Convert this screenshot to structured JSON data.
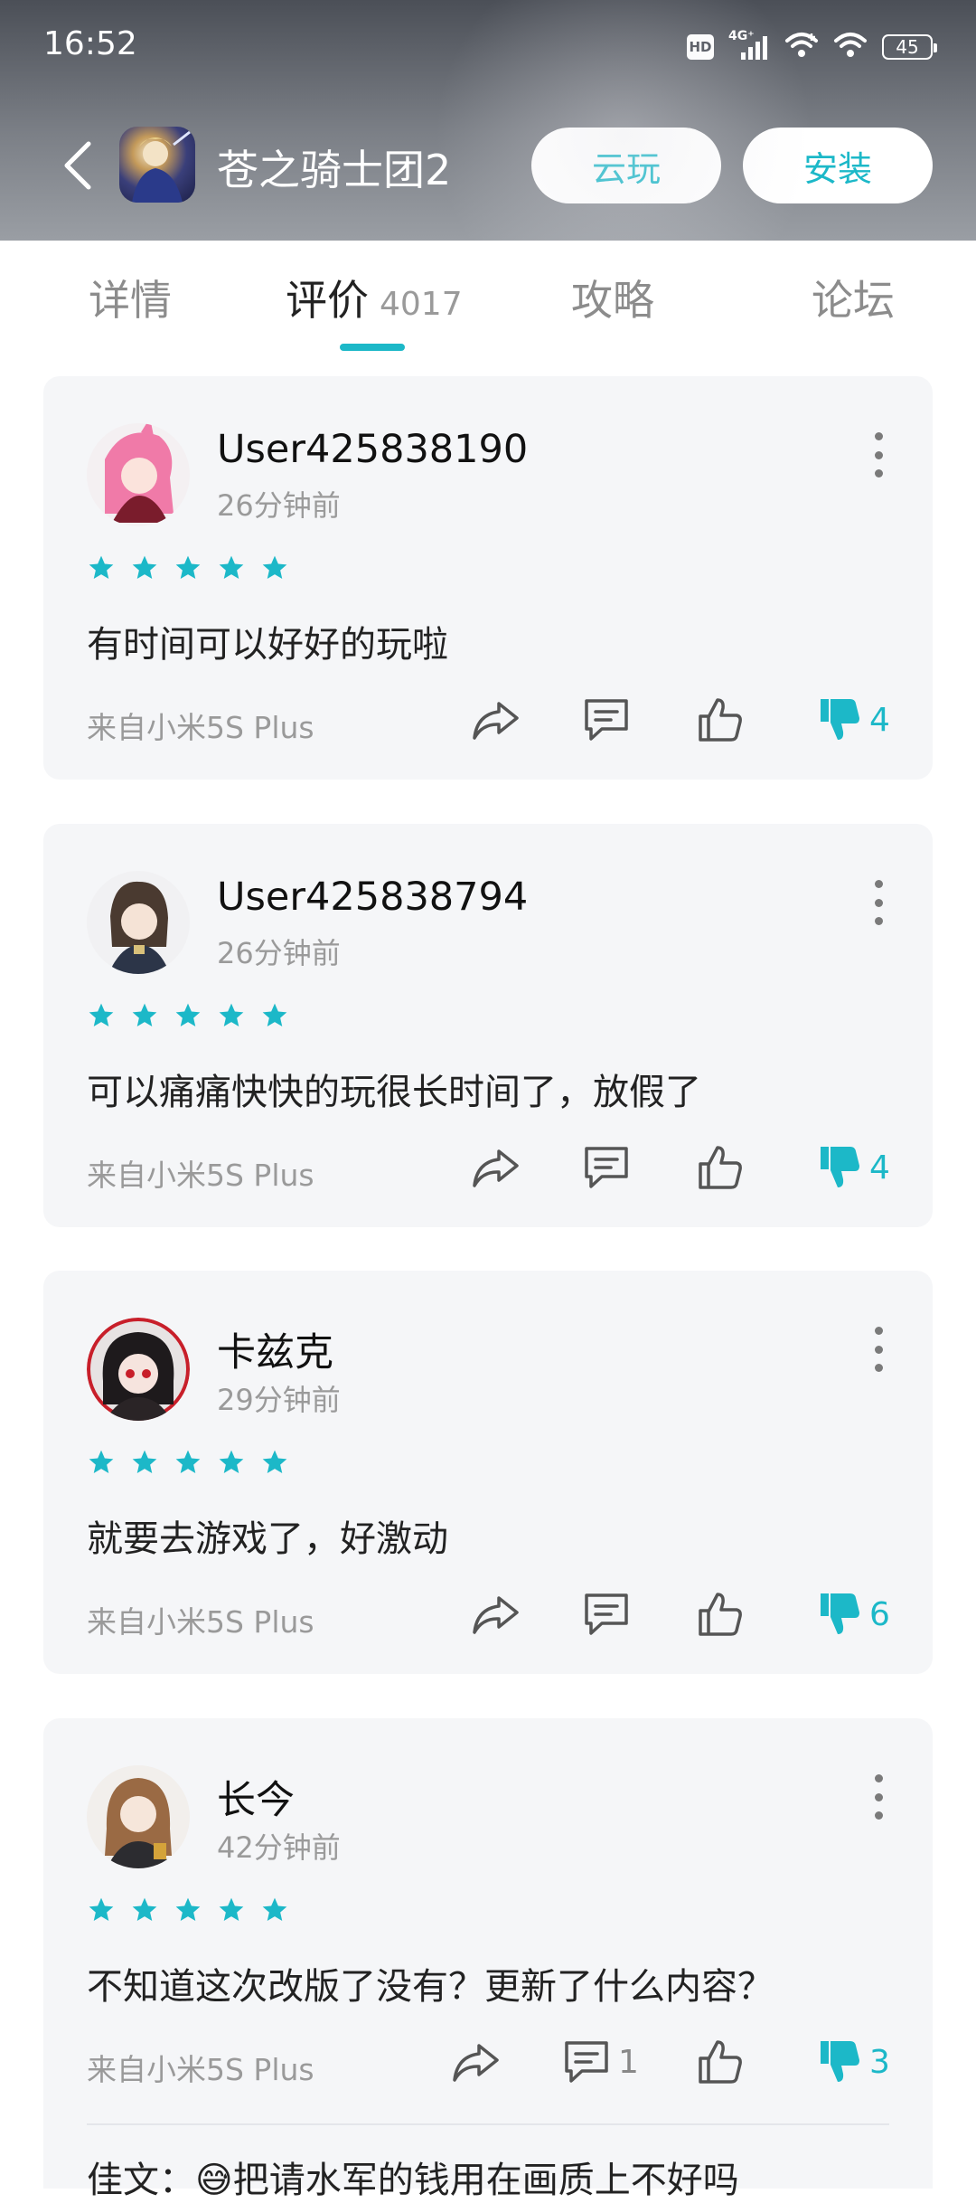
{
  "status_bar": {
    "time": "16:52",
    "hd": "HD",
    "network": "4G⁺",
    "battery": "45"
  },
  "header": {
    "app_title": "苍之骑士团2",
    "cloud_play_label": "云玩",
    "install_label": "安装"
  },
  "tabs": [
    {
      "label": "详情"
    },
    {
      "label": "评价",
      "count": "4017"
    },
    {
      "label": "攻略"
    },
    {
      "label": "论坛"
    }
  ],
  "colors": {
    "accent": "#1cb8c8",
    "card_bg": "#f5f6f8",
    "text_primary": "#222222",
    "text_secondary": "#9a9a9a"
  },
  "reviews": [
    {
      "user": "User425838190",
      "time": "26分钟前",
      "rating": 5,
      "text": "有时间可以好好的玩啦",
      "device": "来自小米5S Plus",
      "comment_count": "",
      "dislike_count": "4"
    },
    {
      "user": "User425838794",
      "time": "26分钟前",
      "rating": 5,
      "text": "可以痛痛快快的玩很长时间了，放假了",
      "device": "来自小米5S Plus",
      "comment_count": "",
      "dislike_count": "4"
    },
    {
      "user": "卡兹克",
      "time": "29分钟前",
      "rating": 5,
      "text": "就要去游戏了，好激动",
      "device": "来自小米5S Plus",
      "comment_count": "",
      "dislike_count": "6"
    },
    {
      "user": "长今",
      "time": "42分钟前",
      "rating": 5,
      "text": "不知道这次改版了没有？更新了什么内容？",
      "device": "来自小米5S Plus",
      "comment_count": "1",
      "dislike_count": "3",
      "reply_preview": "佳文：😅把请水军的钱用在画质上不好吗"
    }
  ],
  "icons": {
    "back": "chevron-left-icon",
    "share": "share-icon",
    "comment": "comment-icon",
    "like": "thumbs-up-icon",
    "dislike": "thumbs-down-icon",
    "more": "more-vertical-icon",
    "star": "star-icon"
  }
}
